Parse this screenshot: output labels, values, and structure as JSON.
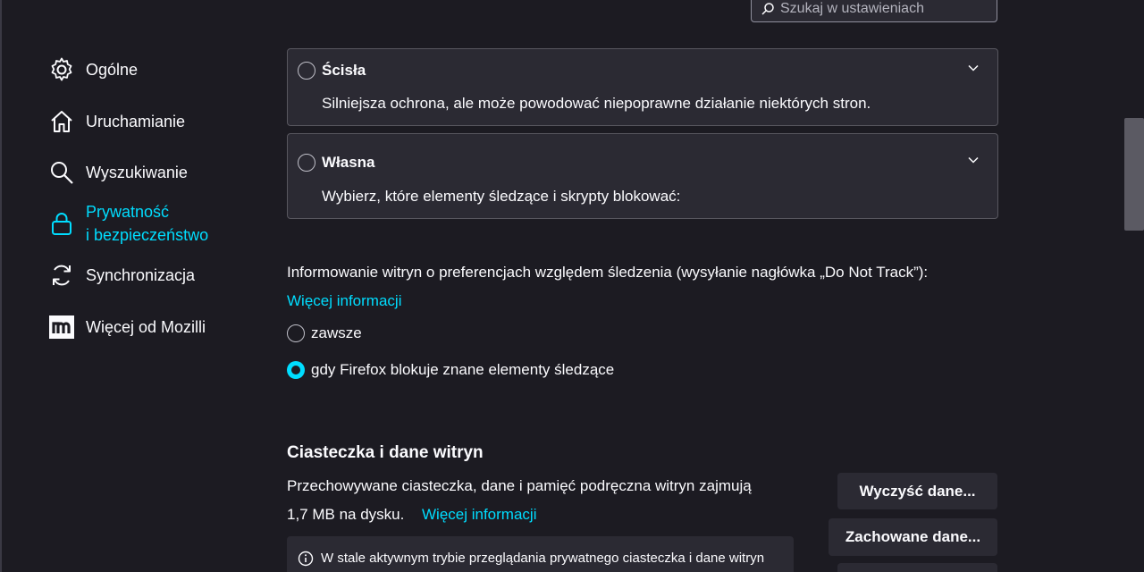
{
  "search": {
    "placeholder": "Szukaj w ustawieniach"
  },
  "sidebar": {
    "items": [
      {
        "label": "Ogólne",
        "icon": "gear-icon"
      },
      {
        "label": "Uruchamianie",
        "icon": "home-icon"
      },
      {
        "label": "Wyszukiwanie",
        "icon": "search-icon"
      },
      {
        "label_line1": "Prywatność",
        "label_line2": "i bezpieczeństwo",
        "icon": "lock-icon",
        "active": true
      },
      {
        "label": "Synchronizacja",
        "icon": "sync-icon"
      },
      {
        "label": "Więcej od Mozilli",
        "icon": "mozilla-icon"
      }
    ]
  },
  "tracking_cards": [
    {
      "title": "Ścisła",
      "description": "Silniejsza ochrona, ale może powodować niepoprawne działanie niektórych stron."
    },
    {
      "title": "Własna",
      "description": "Wybierz, które elementy śledzące i skrypty blokować:"
    }
  ],
  "dnt": {
    "text": "Informowanie witryn o preferencjach względem śledzenia (wysyłanie nagłówka „Do Not Track”):",
    "more_info": "Więcej informacji",
    "options": [
      {
        "label": "zawsze",
        "checked": false
      },
      {
        "label": "gdy Firefox blokuje znane elementy śledzące",
        "checked": true
      }
    ]
  },
  "cookies": {
    "heading": "Ciasteczka i dane witryn",
    "line1": "Przechowywane ciasteczka, dane i pamięć podręczna witryn zajmują",
    "line2": "1,7 MB na dysku.",
    "more_info": "Więcej informacji",
    "clear_button": "Wyczyść dane...",
    "saved_button": "Zachowane dane...",
    "info_text": "W stale aktywnym trybie przeglądania prywatnego ciasteczka i dane witryn"
  },
  "colors": {
    "accent": "#00ddff",
    "background": "#1c1b22",
    "card": "#2b2a33"
  }
}
